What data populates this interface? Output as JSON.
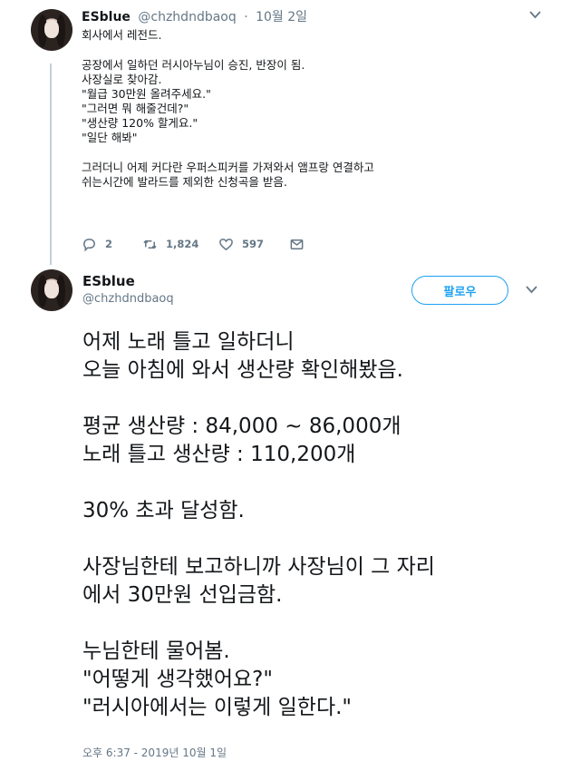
{
  "tweet1": {
    "author_name": "ESblue",
    "author_handle": "@chzhdndbaoq",
    "date": "10월 2일",
    "lines": [
      "회사에서 레전드.",
      "",
      "공장에서 일하던 러시아누님이 승진, 반장이 됨.",
      "사장실로 찾아감.",
      "\"월급 30만원 올려주세요.\"",
      "\"그러면 뭐 해줄건데?\"",
      "\"생산량 120% 할게요.\"",
      "\"일단 해봐\"",
      "",
      "그러더니 어제 커다란 우퍼스피커를 가져와서 앰프랑 연결하고",
      "쉬는시간에 발라드를 제외한 신청곡을 받음."
    ],
    "actions": {
      "reply_icon": "reply-icon",
      "reply_count": "2",
      "retweet_icon": "retweet-icon",
      "retweet_count": "1,824",
      "like_icon": "heart-icon",
      "like_count": "597",
      "dm_icon": "envelope-icon"
    }
  },
  "tweet2": {
    "author_name": "ESblue",
    "author_handle": "@chzhdndbaoq",
    "follow_label": "팔로우",
    "lines": [
      "어제 노래 틀고 일하더니",
      "오늘 아침에 와서 생산량 확인해봤음.",
      "",
      "평균 생산량 : 84,000 ~ 86,000개",
      "노래 틀고 생산량 : 110,200개",
      "",
      "30% 초과 달성함.",
      "",
      "사장님한테 보고하니까 사장님이 그 자리",
      "에서 30만원 선입금함.",
      "",
      "누님한테 물어봄.",
      "\"어떻게 생각했어요?\"",
      "\"러시아에서는 이렇게 일한다.\""
    ],
    "timestamp": "오후 6:37 - 2019년 10월 1일"
  },
  "colors": {
    "accent": "#1da1f2",
    "text": "#14171a",
    "muted": "#657786",
    "thread_line": "#c4cfd6"
  }
}
